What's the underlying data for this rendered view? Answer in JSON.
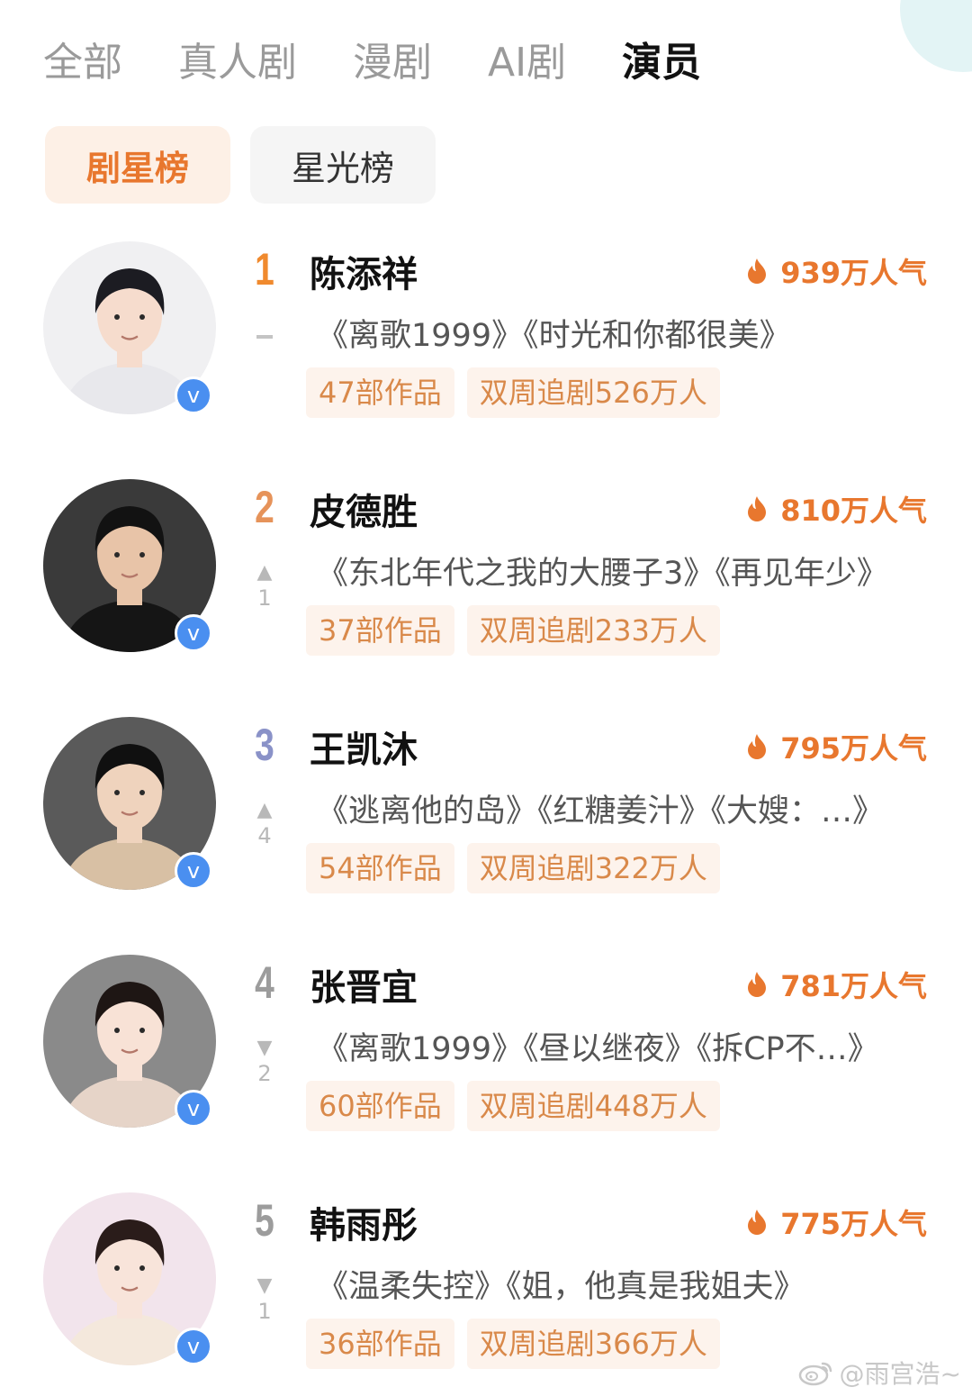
{
  "top_tabs": [
    {
      "label": "全部"
    },
    {
      "label": "真人剧"
    },
    {
      "label": "漫剧"
    },
    {
      "label": "AI剧"
    },
    {
      "label": "演员",
      "active": true
    }
  ],
  "sub_tabs": [
    {
      "label": "剧星榜",
      "active": true
    },
    {
      "label": "星光榜"
    }
  ],
  "verified_badge": "v",
  "rank_colors": {
    "1": "#f08a2e",
    "2": "#e6935a",
    "3": "#8a92c8",
    "4": "#9c9c9c",
    "5": "#9c9c9c"
  },
  "ranks": [
    {
      "rank": "1",
      "name": "陈添祥",
      "popularity": "939万人气",
      "trend": "same",
      "trend_count": "",
      "works": "《离歌1999》《时光和你都很美》",
      "tags": [
        "47部作品",
        "双周追剧526万人"
      ],
      "avatar": {
        "bg": "#f0f0f2",
        "hair": "#1c1c22",
        "skin": "#f6dccd",
        "cloth": "#e8e8ec"
      }
    },
    {
      "rank": "2",
      "name": "皮德胜",
      "popularity": "810万人气",
      "trend": "up",
      "trend_count": "1",
      "works": "《东北年代之我的大腰子3》《再见年少》",
      "tags": [
        "37部作品",
        "双周追剧233万人"
      ],
      "avatar": {
        "bg": "#3a3a3a",
        "hair": "#121212",
        "skin": "#e8c4a8",
        "cloth": "#151515"
      }
    },
    {
      "rank": "3",
      "name": "王凯沐",
      "popularity": "795万人气",
      "trend": "up",
      "trend_count": "4",
      "works": "《逃离他的岛》《红糖姜汁》《大嫂：…》",
      "tags": [
        "54部作品",
        "双周追剧322万人"
      ],
      "avatar": {
        "bg": "#5a5a5a",
        "hair": "#101010",
        "skin": "#efd3bd",
        "cloth": "#d8c0a4"
      }
    },
    {
      "rank": "4",
      "name": "张晋宜",
      "popularity": "781万人气",
      "trend": "down",
      "trend_count": "2",
      "works": "《离歌1999》《昼以继夜》《拆CP不…》",
      "tags": [
        "60部作品",
        "双周追剧448万人"
      ],
      "avatar": {
        "bg": "#8a8a8a",
        "hair": "#1e1614",
        "skin": "#f8e2d6",
        "cloth": "#e6d4c8"
      }
    },
    {
      "rank": "5",
      "name": "韩雨彤",
      "popularity": "775万人气",
      "trend": "down",
      "trend_count": "1",
      "works": "《温柔失控》《姐，他真是我姐夫》",
      "tags": [
        "36部作品",
        "双周追剧366万人"
      ],
      "avatar": {
        "bg": "#f2e4ec",
        "hair": "#2a1c1a",
        "skin": "#f8e4da",
        "cloth": "#f4e8dc"
      }
    }
  ],
  "watermark": "@雨宫浩~",
  "colors": {
    "accent": "#e8772e",
    "tag_bg": "#fdf3ec",
    "tag_text": "#d9894a",
    "verified": "#4a8ff0"
  }
}
